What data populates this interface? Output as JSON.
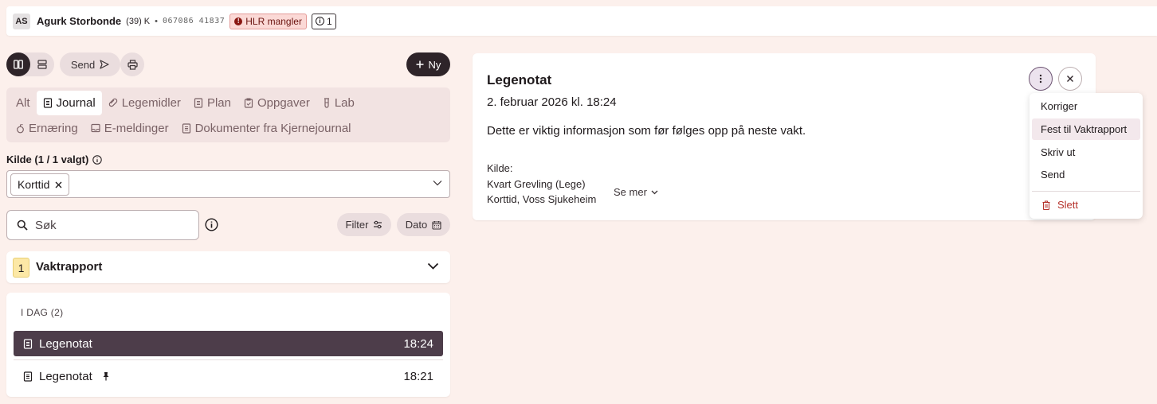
{
  "patient": {
    "initials": "AS",
    "name": "Agurk Storbonde",
    "age_sex": "(39) K",
    "separator": "•",
    "id": "067086 41837",
    "hlr_badge": "HLR mangler",
    "hlr_icon_glyph": "!",
    "info_glyph": "i",
    "info_count": "1"
  },
  "toolbar": {
    "send_label": "Send",
    "new_label": "Ny"
  },
  "tabs": {
    "row1": [
      {
        "label": "Alt",
        "icon": "none"
      },
      {
        "label": "Journal",
        "icon": "document-icon",
        "active": true
      },
      {
        "label": "Legemidler",
        "icon": "pill-icon"
      },
      {
        "label": "Plan",
        "icon": "document-icon"
      },
      {
        "label": "Oppgaver",
        "icon": "clipboard-icon"
      },
      {
        "label": "Lab",
        "icon": "test-tube-icon"
      }
    ],
    "row2": [
      {
        "label": "Ernæring",
        "icon": "nutrition-icon"
      },
      {
        "label": "E-meldinger",
        "icon": "inbox-icon"
      },
      {
        "label": "Dokumenter fra Kjernejournal",
        "icon": "document-icon"
      }
    ]
  },
  "kilde": {
    "label": "Kilde (1 / 1 valgt)",
    "chip": "Korttid"
  },
  "search": {
    "placeholder": "Søk",
    "filter_label": "Filter",
    "date_label": "Dato"
  },
  "vaktrapport": {
    "count": "1",
    "title": "Vaktrapport"
  },
  "list": {
    "heading": "I DAG (2)",
    "items": [
      {
        "title": "Legenotat",
        "time": "18:24",
        "selected": true,
        "pinned": false
      },
      {
        "title": "Legenotat",
        "time": "18:21",
        "selected": false,
        "pinned": true
      }
    ]
  },
  "detail": {
    "title": "Legenotat",
    "date": "2. februar 2026 kl. 18:24",
    "body": "Dette er viktig informasjon som før følges opp på neste vakt.",
    "source_label": "Kilde:",
    "source_author": "Kvart Grevling (Lege)",
    "source_unit": "Korttid, Voss Sjukeheim",
    "see_more": "Se mer"
  },
  "menu": {
    "items": [
      "Korriger",
      "Fest til Vaktrapport",
      "Skriv ut",
      "Send"
    ],
    "delete_label": "Slett"
  },
  "colors": {
    "background": "#fcf0ec",
    "accent_dark": "#2e2429",
    "selected_row": "#4d3d4a",
    "danger": "#b5322b",
    "badge_yellow": "#fce8a6",
    "hlr_bg": "#fbd9d6"
  }
}
